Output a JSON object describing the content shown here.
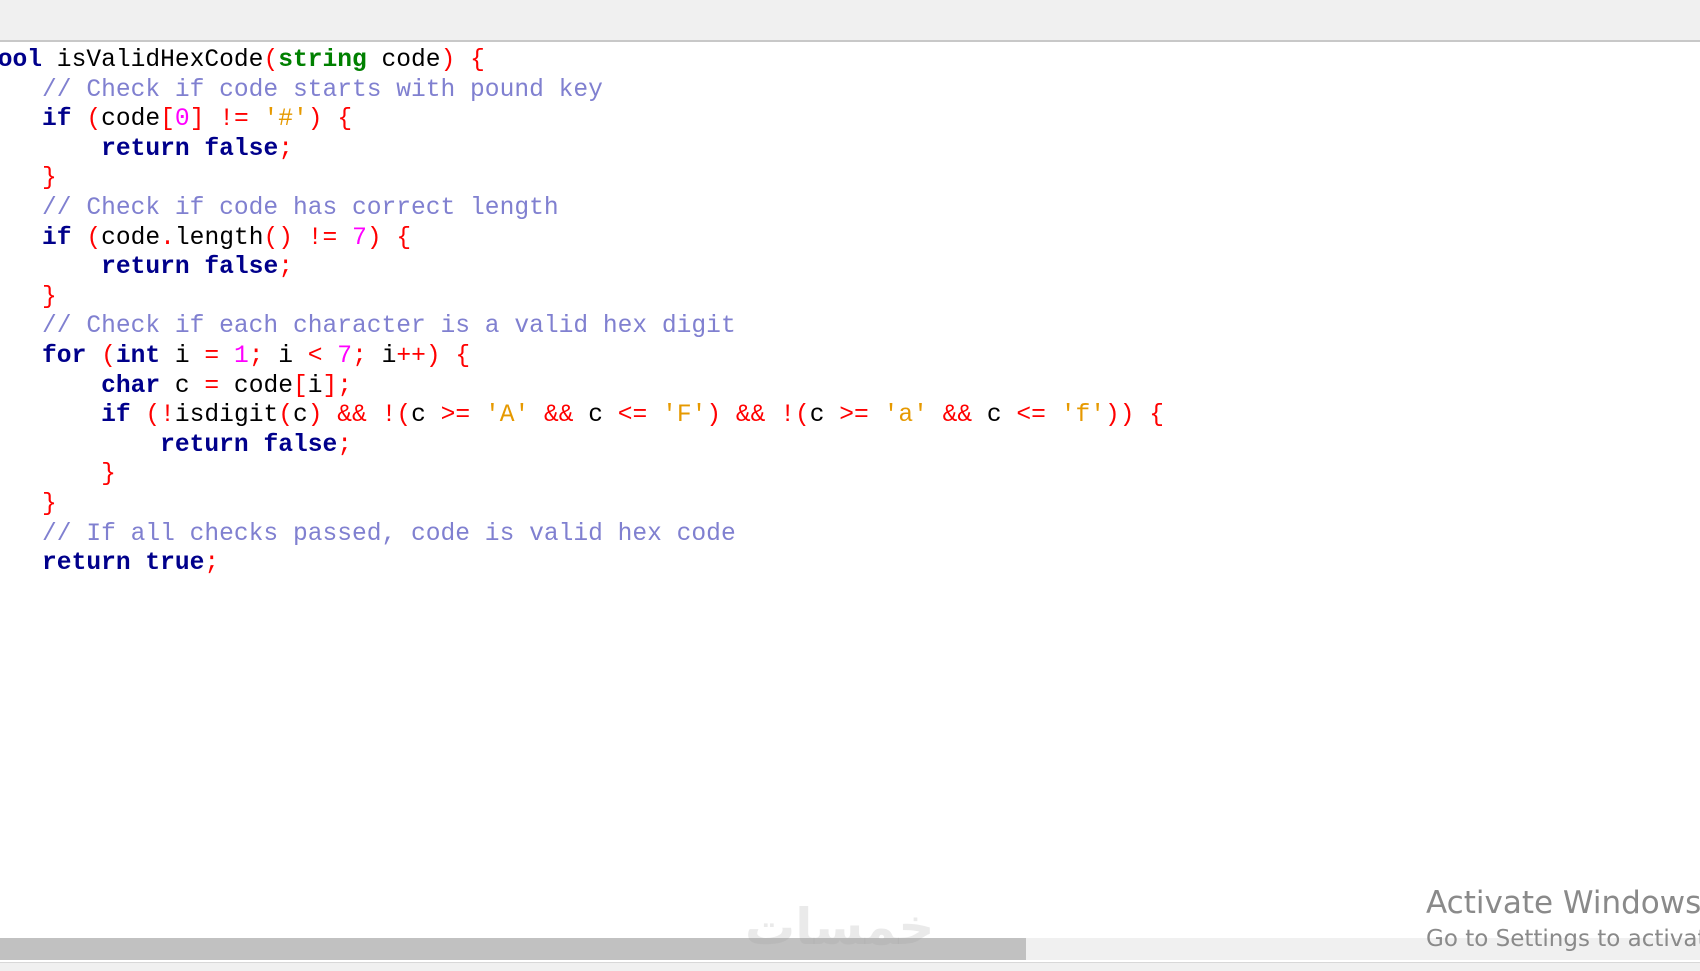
{
  "editor": {
    "lines": [
      [
        [
          "kw",
          "bool"
        ],
        [
          "fn",
          " isValidHexCode"
        ],
        [
          "op",
          "("
        ],
        [
          "ty",
          "string"
        ],
        [
          "fn",
          " code"
        ],
        [
          "op",
          ")"
        ],
        [
          "fn",
          " "
        ],
        [
          "op",
          "{"
        ]
      ],
      [
        [
          "fn",
          "    "
        ],
        [
          "cm",
          "// Check if code starts with pound key"
        ]
      ],
      [
        [
          "fn",
          "    "
        ],
        [
          "kw",
          "if"
        ],
        [
          "fn",
          " "
        ],
        [
          "op",
          "("
        ],
        [
          "fn",
          "code"
        ],
        [
          "op",
          "["
        ],
        [
          "num",
          "0"
        ],
        [
          "op",
          "]"
        ],
        [
          "fn",
          " "
        ],
        [
          "op",
          "!="
        ],
        [
          "fn",
          " "
        ],
        [
          "str",
          "'#'"
        ],
        [
          "op",
          ")"
        ],
        [
          "fn",
          " "
        ],
        [
          "op",
          "{"
        ]
      ],
      [
        [
          "fn",
          "        "
        ],
        [
          "kw",
          "return"
        ],
        [
          "fn",
          " "
        ],
        [
          "kw",
          "false"
        ],
        [
          "op",
          ";"
        ]
      ],
      [
        [
          "fn",
          "    "
        ],
        [
          "op",
          "}"
        ]
      ],
      [
        [
          "fn",
          "    "
        ],
        [
          "cm",
          "// Check if code has correct length"
        ]
      ],
      [
        [
          "fn",
          "    "
        ],
        [
          "kw",
          "if"
        ],
        [
          "fn",
          " "
        ],
        [
          "op",
          "("
        ],
        [
          "fn",
          "code"
        ],
        [
          "op",
          "."
        ],
        [
          "fn",
          "length"
        ],
        [
          "op",
          "()"
        ],
        [
          "fn",
          " "
        ],
        [
          "op",
          "!="
        ],
        [
          "fn",
          " "
        ],
        [
          "num",
          "7"
        ],
        [
          "op",
          ")"
        ],
        [
          "fn",
          " "
        ],
        [
          "op",
          "{"
        ]
      ],
      [
        [
          "fn",
          "        "
        ],
        [
          "kw",
          "return"
        ],
        [
          "fn",
          " "
        ],
        [
          "kw",
          "false"
        ],
        [
          "op",
          ";"
        ]
      ],
      [
        [
          "fn",
          "    "
        ],
        [
          "op",
          "}"
        ]
      ],
      [
        [
          "fn",
          "    "
        ],
        [
          "cm",
          "// Check if each character is a valid hex digit"
        ]
      ],
      [
        [
          "fn",
          "    "
        ],
        [
          "kw",
          "for"
        ],
        [
          "fn",
          " "
        ],
        [
          "op",
          "("
        ],
        [
          "kw",
          "int"
        ],
        [
          "fn",
          " i "
        ],
        [
          "op",
          "="
        ],
        [
          "fn",
          " "
        ],
        [
          "num",
          "1"
        ],
        [
          "op",
          ";"
        ],
        [
          "fn",
          " i "
        ],
        [
          "op",
          "<"
        ],
        [
          "fn",
          " "
        ],
        [
          "num",
          "7"
        ],
        [
          "op",
          ";"
        ],
        [
          "fn",
          " i"
        ],
        [
          "op",
          "++)"
        ],
        [
          "fn",
          " "
        ],
        [
          "op",
          "{"
        ]
      ],
      [
        [
          "fn",
          "        "
        ],
        [
          "kw",
          "char"
        ],
        [
          "fn",
          " c "
        ],
        [
          "op",
          "="
        ],
        [
          "fn",
          " code"
        ],
        [
          "op",
          "["
        ],
        [
          "fn",
          "i"
        ],
        [
          "op",
          "];"
        ]
      ],
      [
        [
          "fn",
          "        "
        ],
        [
          "kw",
          "if"
        ],
        [
          "fn",
          " "
        ],
        [
          "op",
          "(!"
        ],
        [
          "fn",
          "isdigit"
        ],
        [
          "op",
          "("
        ],
        [
          "fn",
          "c"
        ],
        [
          "op",
          ")"
        ],
        [
          "fn",
          " "
        ],
        [
          "op",
          "&&"
        ],
        [
          "fn",
          " "
        ],
        [
          "op",
          "!("
        ],
        [
          "fn",
          "c "
        ],
        [
          "op",
          ">="
        ],
        [
          "fn",
          " "
        ],
        [
          "str",
          "'A'"
        ],
        [
          "fn",
          " "
        ],
        [
          "op",
          "&&"
        ],
        [
          "fn",
          " c "
        ],
        [
          "op",
          "<="
        ],
        [
          "fn",
          " "
        ],
        [
          "str",
          "'F'"
        ],
        [
          "op",
          ")"
        ],
        [
          "fn",
          " "
        ],
        [
          "op",
          "&&"
        ],
        [
          "fn",
          " "
        ],
        [
          "op",
          "!("
        ],
        [
          "fn",
          "c "
        ],
        [
          "op",
          ">="
        ],
        [
          "fn",
          " "
        ],
        [
          "str",
          "'a'"
        ],
        [
          "fn",
          " "
        ],
        [
          "op",
          "&&"
        ],
        [
          "fn",
          " c "
        ],
        [
          "op",
          "<="
        ],
        [
          "fn",
          " "
        ],
        [
          "str",
          "'f'"
        ],
        [
          "op",
          "))"
        ],
        [
          "fn",
          " "
        ],
        [
          "op",
          "{"
        ]
      ],
      [
        [
          "fn",
          "            "
        ],
        [
          "kw",
          "return"
        ],
        [
          "fn",
          " "
        ],
        [
          "kw",
          "false"
        ],
        [
          "op",
          ";"
        ]
      ],
      [
        [
          "fn",
          "        "
        ],
        [
          "op",
          "}"
        ]
      ],
      [
        [
          "fn",
          "    "
        ],
        [
          "op",
          "}"
        ]
      ],
      [
        [
          "fn",
          "    "
        ],
        [
          "cm",
          "// If all checks passed, code is valid hex code"
        ]
      ],
      [
        [
          "fn",
          "    "
        ],
        [
          "kw",
          "return"
        ],
        [
          "fn",
          " "
        ],
        [
          "kw",
          "true"
        ],
        [
          "op",
          ";"
        ]
      ]
    ]
  },
  "watermark": {
    "logo_text": "خمسات",
    "activate_title": "Activate Windows",
    "activate_subtitle": "Go to Settings to activate Windows."
  }
}
